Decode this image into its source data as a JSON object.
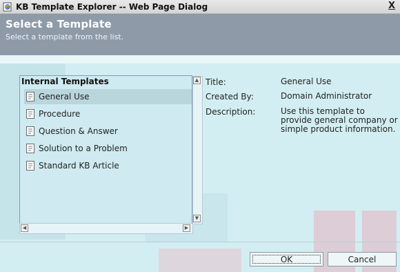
{
  "window": {
    "title": "KB Template Explorer -- Web Page Dialog",
    "close_label": "X"
  },
  "header": {
    "title": "Select a Template",
    "subtitle": "Select a template from the list."
  },
  "list": {
    "heading": "Internal Templates",
    "selected": "General Use",
    "items": [
      {
        "label": "General Use"
      },
      {
        "label": "Procedure"
      },
      {
        "label": "Question & Answer"
      },
      {
        "label": "Solution to a Problem"
      },
      {
        "label": "Standard KB Article"
      }
    ]
  },
  "details": {
    "title_label": "Title:",
    "title_value": "General Use",
    "created_label": "Created By:",
    "created_value": "Domain Administrator",
    "desc_label": "Description:",
    "desc_value": "Use this template to provide general company or simple product information."
  },
  "buttons": {
    "ok": "OK",
    "cancel": "Cancel"
  }
}
